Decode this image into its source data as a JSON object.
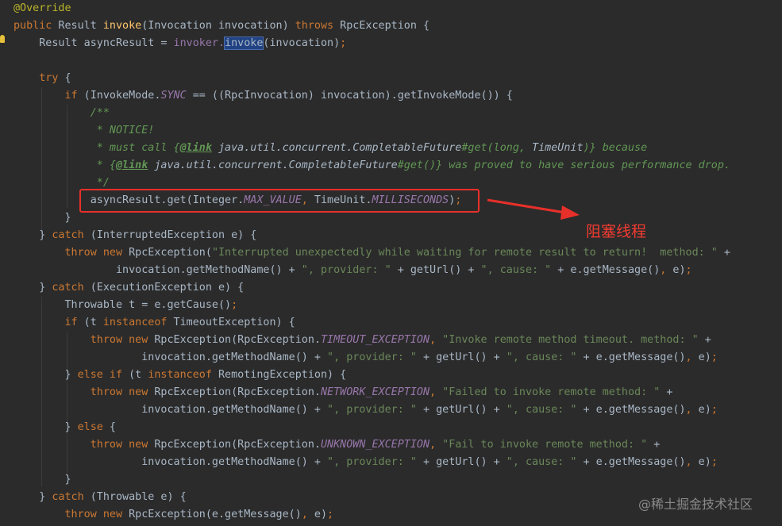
{
  "code": {
    "l1": {
      "t0": "@Override"
    },
    "l2": {
      "t0": "public",
      "t1": " Result ",
      "t2": "invoke",
      "t3": "(Invocation invocation) ",
      "t4": "throws",
      "t5": " RpcException {"
    },
    "l3": {
      "t0": "    Result asyncResult = ",
      "t1": "invoker.",
      "t2": "invoke",
      "t3": "(invocation)",
      "t4": ";"
    },
    "l5": {
      "t0": "    ",
      "t1": "try",
      "t2": " {"
    },
    "l6": {
      "t0": "        ",
      "t1": "if",
      "t2": " (InvokeMode.",
      "t3": "SYNC",
      "t4": " == ((RpcInvocation) invocation).getInvokeMode()) {"
    },
    "l7": {
      "t0": "            /**"
    },
    "l8": {
      "t0": "             * NOTICE!"
    },
    "l9": {
      "t0": "             * must call {",
      "t1": "@link",
      "t2": " java.util.concurrent.CompletableFuture",
      "t3": "#get(long, ",
      "t4": "TimeUnit",
      "t5": ")} because"
    },
    "l10": {
      "t0": "             * {",
      "t1": "@link",
      "t2": " java.util.concurrent.CompletableFuture",
      "t3": "#get()} was proved to have serious performance drop."
    },
    "l11": {
      "t0": "             */"
    },
    "l12": {
      "t0": "            asyncResult.get(Integer.",
      "t1": "MAX_VALUE",
      "t2": ", ",
      "t3": "TimeUnit.",
      "t4": "MILLISECONDS",
      "t5": ")",
      "t6": ";"
    },
    "l13": {
      "t0": "        }"
    },
    "l14": {
      "t0": "    } ",
      "t1": "catch",
      "t2": " (InterruptedException e) {"
    },
    "l15": {
      "t0": "        ",
      "t1": "throw new",
      "t2": " RpcException(",
      "t3": "\"Interrupted unexpectedly while waiting for remote result to return!  method: \"",
      "t4": " +"
    },
    "l16": {
      "t0": "                invocation.getMethodName() + ",
      "t1": "\", provider: \"",
      "t2": " + getUrl() + ",
      "t3": "\", cause: \"",
      "t4": " + e.getMessage()",
      "t5": ", ",
      "t6": "e)",
      "t7": ";"
    },
    "l17": {
      "t0": "    } ",
      "t1": "catch",
      "t2": " (ExecutionException e) {"
    },
    "l18": {
      "t0": "        Throwable t = e.getCause()",
      "t1": ";"
    },
    "l19": {
      "t0": "        ",
      "t1": "if",
      "t2": " (t ",
      "t3": "instanceof",
      "t4": " TimeoutException) {"
    },
    "l20": {
      "t0": "            ",
      "t1": "throw new",
      "t2": " RpcException(RpcException.",
      "t3": "TIMEOUT_EXCEPTION",
      "t4": ", ",
      "t5": "\"Invoke remote method timeout. method: \"",
      "t6": " +"
    },
    "l21": {
      "t0": "                    invocation.getMethodName() + ",
      "t1": "\", provider: \"",
      "t2": " + getUrl() + ",
      "t3": "\", cause: \"",
      "t4": " + e.getMessage()",
      "t5": ", ",
      "t6": "e)",
      "t7": ";"
    },
    "l22": {
      "t0": "        } ",
      "t1": "else if",
      "t2": " (t ",
      "t3": "instanceof",
      "t4": " RemotingException) {"
    },
    "l23": {
      "t0": "            ",
      "t1": "throw new",
      "t2": " RpcException(RpcException.",
      "t3": "NETWORK_EXCEPTION",
      "t4": ", ",
      "t5": "\"Failed to invoke remote method: \"",
      "t6": " +"
    },
    "l24": {
      "t0": "                    invocation.getMethodName() + ",
      "t1": "\", provider: \"",
      "t2": " + getUrl() + ",
      "t3": "\", cause: \"",
      "t4": " + e.getMessage()",
      "t5": ", ",
      "t6": "e)",
      "t7": ";"
    },
    "l25": {
      "t0": "        } ",
      "t1": "else",
      "t2": " {"
    },
    "l26": {
      "t0": "            ",
      "t1": "throw new",
      "t2": " RpcException(RpcException.",
      "t3": "UNKNOWN_EXCEPTION",
      "t4": ", ",
      "t5": "\"Fail to invoke remote method: \"",
      "t6": " +"
    },
    "l27": {
      "t0": "                    invocation.getMethodName() + ",
      "t1": "\", provider: \"",
      "t2": " + getUrl() + ",
      "t3": "\", cause: \"",
      "t4": " + e.getMessage()",
      "t5": ", ",
      "t6": "e)",
      "t7": ";"
    },
    "l28": {
      "t0": "        }"
    },
    "l29": {
      "t0": "    } ",
      "t1": "catch",
      "t2": " (Throwable e) {"
    },
    "l30": {
      "t0": "        ",
      "t1": "throw new",
      "t2": " RpcException(e.getMessage()",
      "t3": ", ",
      "t4": "e)",
      "t5": ";"
    }
  },
  "callout": {
    "label": "阻塞线程"
  },
  "watermark": "@稀土掘金技术社区",
  "icons": {
    "intention": "lightbulb-icon",
    "arrow": "red-arrow-icon"
  },
  "colors": {
    "keyword": "#cc7832",
    "string": "#6a8759",
    "comment": "#629755",
    "constant": "#9876aa",
    "annotation": "#bbb529",
    "callout": "#e8302a"
  }
}
